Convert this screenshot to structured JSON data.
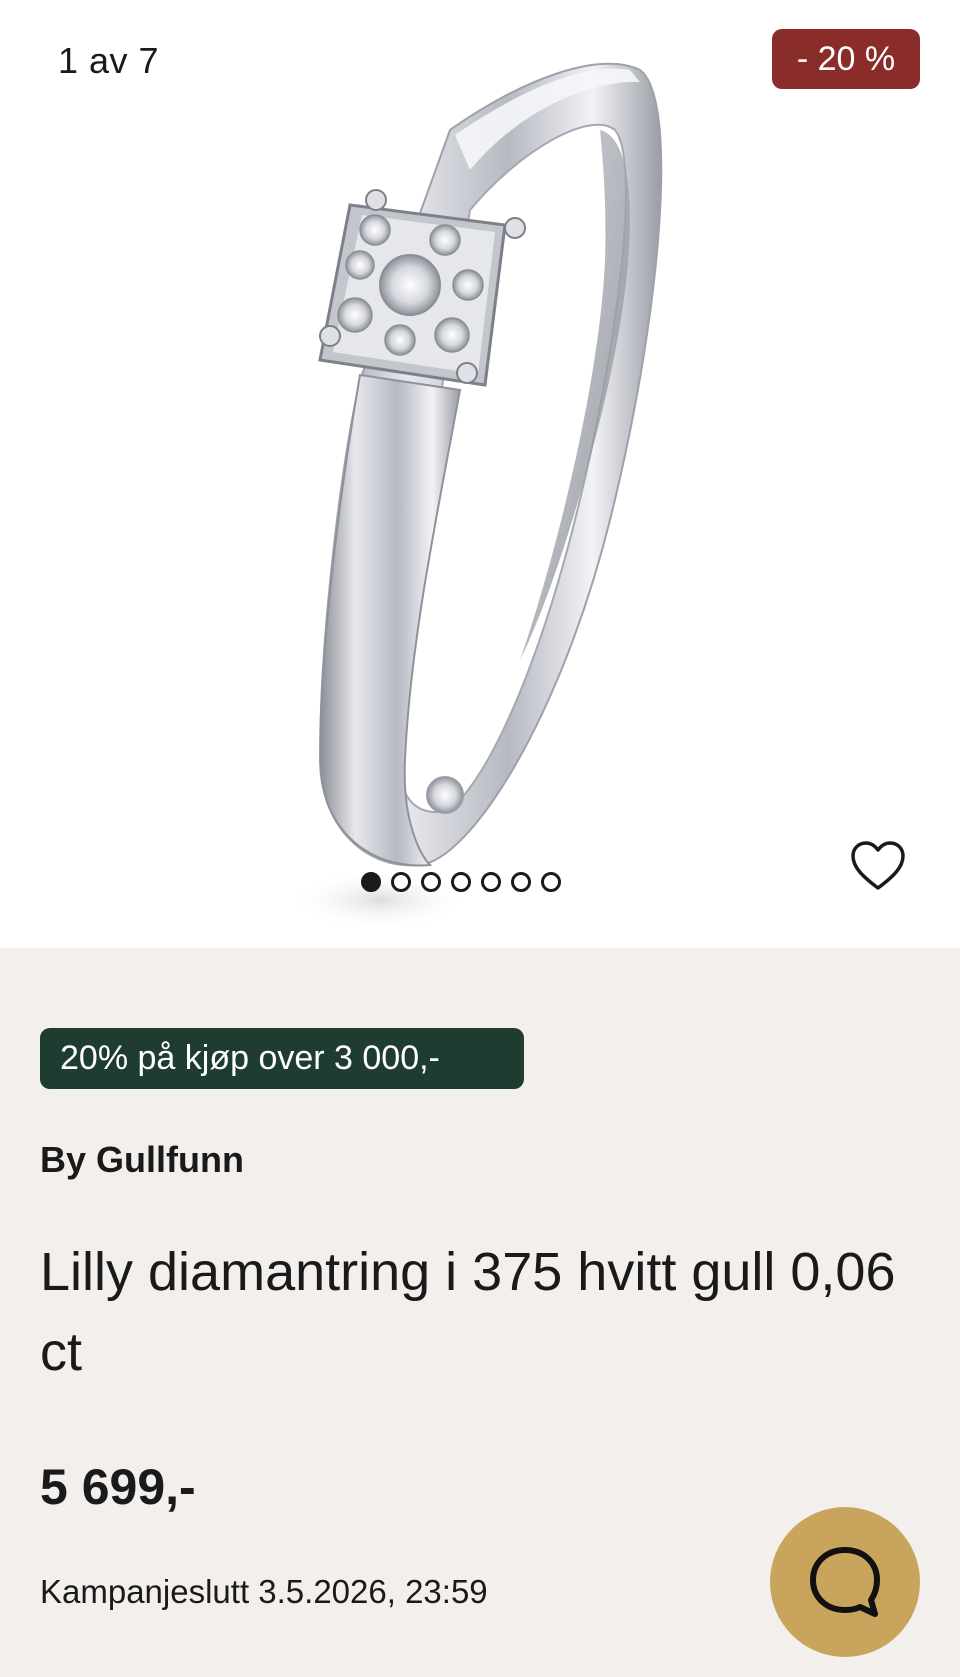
{
  "gallery": {
    "counter_text": "1 av 7",
    "discount_badge": "- 20 %",
    "image_count": 7,
    "active_image": 1
  },
  "product": {
    "promo_label": "20% på kjøp over 3 000,-",
    "brand": "By Gullfunn",
    "title": "Lilly diamantring i 375 hvitt gull 0,06 ct",
    "price": "5 699,-",
    "campaign_end": "Kampanjeslutt 3.5.2026, 23:59"
  },
  "icons": {
    "favorite": "heart-outline-icon",
    "chat": "chat-bubble-icon"
  },
  "colors": {
    "discount_badge_bg": "#8a2c2a",
    "promo_bg": "#1e3d30",
    "chat_button_bg": "#c9a45c",
    "page_bg": "#f2efec"
  }
}
